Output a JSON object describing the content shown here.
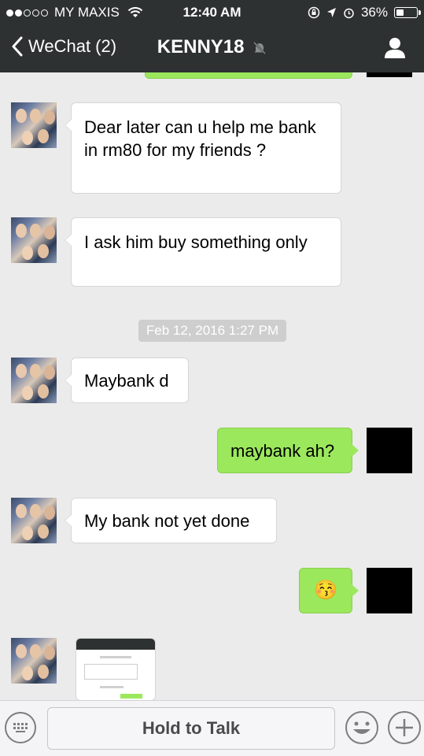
{
  "status_bar": {
    "carrier": "MY MAXIS",
    "time": "12:40 AM",
    "battery": "36%"
  },
  "nav": {
    "back_label": "WeChat (2)",
    "title": "KENNY18"
  },
  "messages": [
    {
      "from": "contact",
      "text": "Dear later can u help me bank in rm80 for my friends ?"
    },
    {
      "from": "contact",
      "text": "I ask him buy something only"
    },
    {
      "from": "contact",
      "text": "Maybank d"
    },
    {
      "from": "me",
      "text": "maybank ah?"
    },
    {
      "from": "contact",
      "text": "My bank not yet done"
    },
    {
      "from": "me",
      "text": "😚"
    }
  ],
  "timestamp": "Feb 12, 2016 1:27 PM",
  "input": {
    "hold_to_talk": "Hold to Talk"
  },
  "colors": {
    "header_bg": "#2e3132",
    "chat_bg": "#ebebeb",
    "outgoing_bubble": "#9ce85d",
    "incoming_bubble": "#ffffff"
  }
}
